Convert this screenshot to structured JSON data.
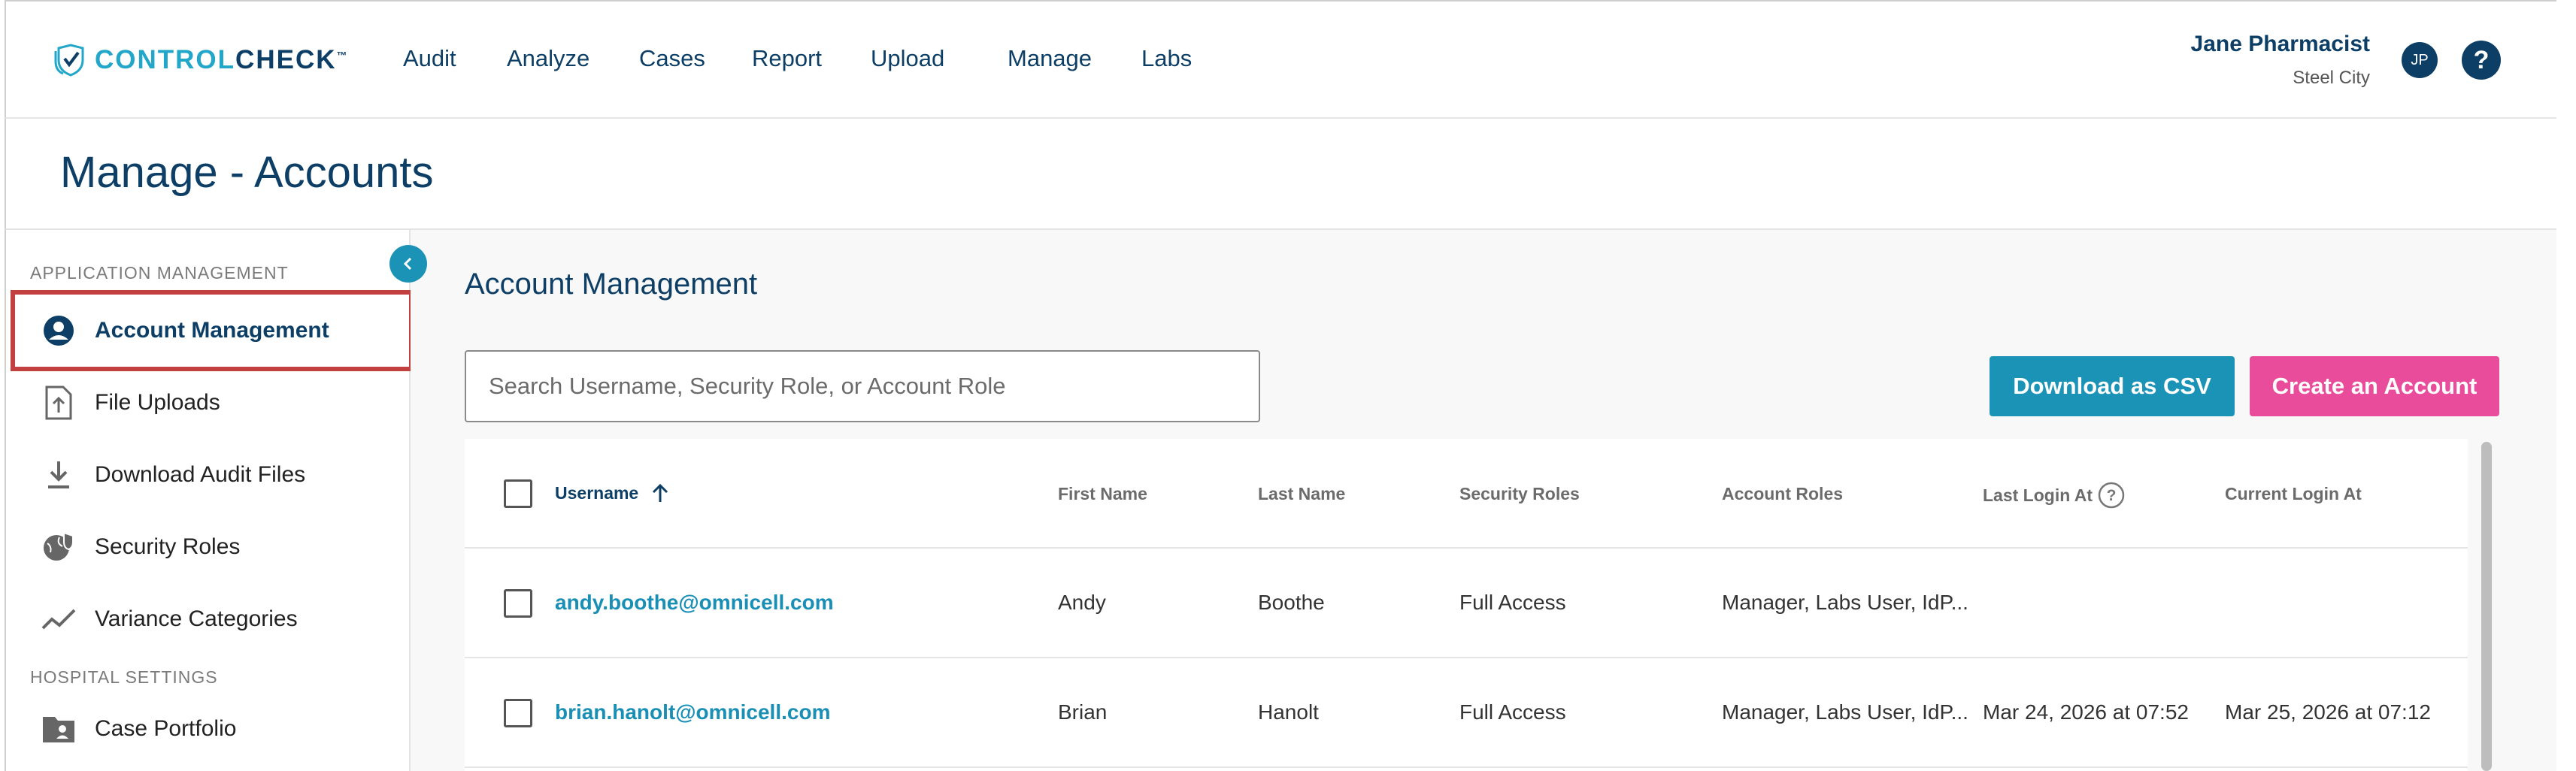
{
  "header": {
    "logo": {
      "part1": "CONTROL",
      "part2": "CHECK",
      "mark": "™"
    },
    "nav": [
      {
        "label": "Audit"
      },
      {
        "label": "Analyze"
      },
      {
        "label": "Cases"
      },
      {
        "label": "Report"
      },
      {
        "label": "Upload"
      },
      {
        "label": "Manage"
      },
      {
        "label": "Labs"
      }
    ],
    "user": {
      "name": "Jane Pharmacist",
      "location": "Steel City",
      "initials": "JP"
    },
    "help_label": "?"
  },
  "page": {
    "title": "Manage - Accounts"
  },
  "sidebar": {
    "sections": [
      {
        "label": "APPLICATION MANAGEMENT"
      },
      {
        "label": "HOSPITAL SETTINGS"
      }
    ],
    "items": [
      {
        "label": "Account Management",
        "icon": "account-circle-icon",
        "active": true
      },
      {
        "label": "File Uploads",
        "icon": "file-upload-icon"
      },
      {
        "label": "Download Audit Files",
        "icon": "download-icon"
      },
      {
        "label": "Security Roles",
        "icon": "security-globe-icon"
      },
      {
        "label": "Variance Categories",
        "icon": "trend-line-icon"
      },
      {
        "label": "Case Portfolio",
        "icon": "folder-person-icon"
      }
    ]
  },
  "main": {
    "title": "Account Management",
    "search": {
      "placeholder": "Search Username, Security Role, or Account Role",
      "value": ""
    },
    "buttons": {
      "download_csv": "Download as CSV",
      "create_account": "Create an Account"
    },
    "table": {
      "columns": [
        "Username",
        "First Name",
        "Last Name",
        "Security Roles",
        "Account Roles",
        "Last Login At",
        "Current Login At"
      ],
      "sort": {
        "column": "Username",
        "direction": "ascending"
      },
      "rows": [
        {
          "username": "andy.boothe@omnicell.com",
          "first": "Andy",
          "last": "Boothe",
          "security": "Full Access",
          "account": "Manager, Labs User, IdP...",
          "last_login": "",
          "current_login": ""
        },
        {
          "username": "brian.hanolt@omnicell.com",
          "first": "Brian",
          "last": "Hanolt",
          "security": "Full Access",
          "account": "Manager, Labs User, IdP...",
          "last_login": "Mar 24, 2026 at 07:52",
          "current_login": "Mar 25, 2026 at 07:12"
        }
      ]
    }
  },
  "colors": {
    "navy": "#0d3e66",
    "teal": "#1a93b7",
    "pink": "#e84c9a",
    "active_outline": "#c34040"
  }
}
